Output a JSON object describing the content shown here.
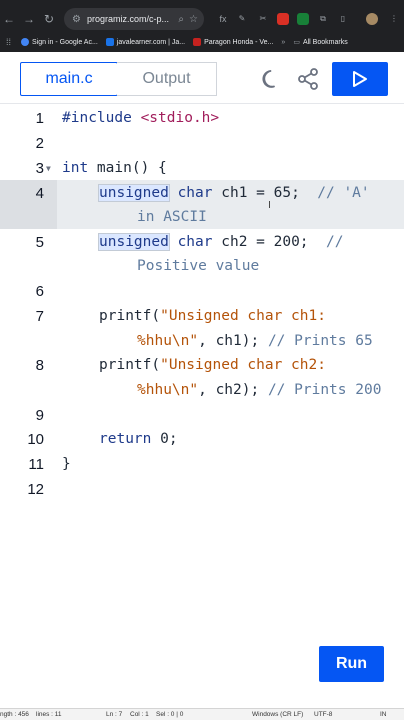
{
  "browser": {
    "url": "programiz.com/c-p...",
    "bookmarks": [
      {
        "label": "Sign in - Google Ac..."
      },
      {
        "label": "javalearner.com | Ja..."
      },
      {
        "label": "Paragon Honda - Ve..."
      }
    ],
    "all_bookmarks": "All Bookmarks"
  },
  "editor": {
    "tab_active": "main.c",
    "tab_output": "Output",
    "run_label": "Run"
  },
  "code": {
    "line_numbers": [
      "1",
      "2",
      "3",
      "4",
      "5",
      "6",
      "7",
      "8",
      "9",
      "10",
      "11",
      "12"
    ],
    "l1": {
      "kw": "#include",
      "inc": "<stdio.h>"
    },
    "l3": {
      "t1": "int",
      "t2": " main() {"
    },
    "l4": {
      "kw1": "unsigned",
      "kw2": " char",
      "t": " ch1 = 65;  ",
      "cm": "// 'A'",
      "cont": "in ASCII"
    },
    "l5": {
      "kw1": "unsigned",
      "kw2": " char",
      "t": " ch2 = 200;  ",
      "cm": "//",
      "cont": "Positive value"
    },
    "l7": {
      "t1": "printf(",
      "s1": "\"Unsigned char ch1:",
      "s2": "%hhu\\n\"",
      "t2": ", ch1); ",
      "cm": "// Prints 65"
    },
    "l8": {
      "t1": "printf(",
      "s1": "\"Unsigned char ch2:",
      "s2": "%hhu\\n\"",
      "t2": ", ch2); ",
      "cm": "// Prints 200"
    },
    "l10": {
      "kw": "return",
      "t": " 0;"
    },
    "l11": {
      "t": "}"
    }
  },
  "status": {
    "length": "ngth : 456",
    "lines": "lines : 11",
    "cursor": "Ln : 7",
    "col": "Col : 1",
    "sel": "Sel : 0 | 0",
    "eol": "Windows (CR LF)",
    "encoding": "UTF-8",
    "mode": "IN"
  },
  "colors": {
    "accent": "#0556f3",
    "highlight": "#e9ecef"
  }
}
